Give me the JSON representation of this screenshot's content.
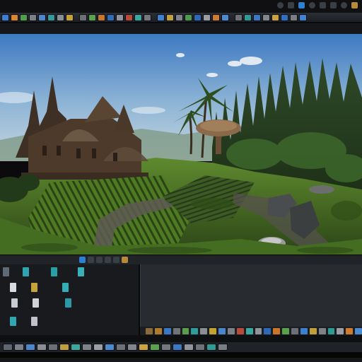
{
  "window": {
    "title": ""
  },
  "toolbar": {
    "buttons": [
      {
        "icon": "blue-gradient-icon",
        "color": "#3a7ed4"
      },
      {
        "icon": "orange-tool-icon",
        "color": "#d9872f"
      },
      {
        "icon": "green-tool-icon",
        "color": "#4f9e4a"
      },
      {
        "icon": "grey-tool-icon",
        "color": "#7b7f86"
      },
      {
        "icon": "blue-tool-icon",
        "color": "#4a86c9"
      },
      {
        "icon": "teal-tool-icon",
        "color": "#2f9c9a"
      },
      {
        "icon": "grey-tool-icon",
        "color": "#8a8d92"
      },
      {
        "icon": "yellow-tool-icon",
        "color": "#c4a232"
      },
      {
        "icon": "grey-tool-icon",
        "color": "#6c7076"
      },
      {
        "icon": "green-tool-icon",
        "color": "#5aa14c"
      },
      {
        "icon": "orange-tool-icon",
        "color": "#c9762a"
      },
      {
        "icon": "blue-tool-icon",
        "color": "#2f6cb8"
      },
      {
        "icon": "grey-tool-icon",
        "color": "#90939a"
      },
      {
        "icon": "red-tool-icon",
        "color": "#b94a3a"
      },
      {
        "icon": "teal-tool-icon",
        "color": "#3aa6a0"
      },
      {
        "icon": "grey-tool-icon",
        "color": "#74787e"
      },
      {
        "icon": "blue-tool-icon",
        "color": "#3d7fd0"
      },
      {
        "icon": "yellow-tool-icon",
        "color": "#bfa03a"
      },
      {
        "icon": "grey-tool-icon",
        "color": "#7e8188"
      },
      {
        "icon": "green-tool-icon",
        "color": "#4c9a4a"
      },
      {
        "icon": "blue-tool-icon",
        "color": "#2c6ab8"
      },
      {
        "icon": "grey-tool-icon",
        "color": "#9a9da3"
      },
      {
        "icon": "orange-tool-icon",
        "color": "#d07a30"
      },
      {
        "icon": "blue-tool-icon",
        "color": "#4c8ad0"
      },
      {
        "icon": "grey-tool-icon",
        "color": "#6e7278"
      },
      {
        "icon": "teal-tool-icon",
        "color": "#2e9a94"
      },
      {
        "icon": "blue-tool-icon",
        "color": "#3b78c4"
      },
      {
        "icon": "grey-tool-icon",
        "color": "#82858b"
      },
      {
        "icon": "yellow-tool-icon",
        "color": "#c9a43c"
      },
      {
        "icon": "blue-tool-icon",
        "color": "#2e6fc0"
      },
      {
        "icon": "grey-tool-icon",
        "color": "#7a7d83"
      },
      {
        "icon": "blue-tool-icon",
        "color": "#3f82d2"
      }
    ]
  },
  "top_right": {
    "icons": [
      "dropdown-icon",
      "settings-icon",
      "blue-status-icon",
      "search-icon",
      "pointer-icon",
      "play-icon",
      "warning-icon",
      "window-icon"
    ]
  },
  "viewport": {
    "scene": "fantasy-village-landscape",
    "colors": {
      "sky_top": "#3f7fc8",
      "sky_bottom": "#bcd3e0",
      "grass_dark": "#2e4a1c",
      "grass_light": "#7aa23a",
      "building": "#4d3a2a",
      "path": "#6e6a62"
    }
  },
  "content_browser": {
    "items": [
      {
        "icon": "folder-icon",
        "color": "#5e6a78"
      },
      {
        "icon": "asset-teal-icon",
        "color": "#2fa3b0"
      },
      {
        "icon": "asset-teal-icon",
        "color": "#29a0a6"
      },
      {
        "icon": "asset-teal-icon",
        "color": "#37b0ba"
      },
      {
        "icon": "asset-white-icon",
        "color": "#d9dde2"
      },
      {
        "icon": "asset-yellow-icon",
        "color": "#c7a43a"
      },
      {
        "icon": "asset-teal-icon",
        "color": "#33aeb6"
      },
      {
        "icon": "asset-white-icon",
        "color": "#c8ccd2"
      },
      {
        "icon": "asset-white-icon",
        "color": "#d0d4d9"
      },
      {
        "icon": "asset-teal-icon",
        "color": "#2c9aa6"
      },
      {
        "icon": "asset-white-icon",
        "color": "#bfc3c9"
      },
      {
        "icon": "asset-teal-icon",
        "color": "#30a6b0"
      }
    ]
  },
  "details_strip": {
    "items": [
      "#8a6a3a",
      "#b07b2c",
      "#3b78c4",
      "#6f7378",
      "#5a9e4c",
      "#2f9c9a",
      "#8a8d92",
      "#c4a232",
      "#4a86c9",
      "#7b7f86",
      "#b94a3a",
      "#3aa6a0",
      "#90939a",
      "#2c6ab8",
      "#c9762a",
      "#5aa14c",
      "#6c7076",
      "#3d7fd0",
      "#bfa03a",
      "#7e8188",
      "#2e9a94",
      "#9a9da3",
      "#d07a30",
      "#4c8ad0"
    ]
  },
  "bottom_toolbar": {
    "items": [
      "#5e6670",
      "#7a8088",
      "#4a86c9",
      "#8a8d92",
      "#6c7076",
      "#bfa03a",
      "#3aa6a0",
      "#7e8188",
      "#9a9da3",
      "#4c8ad0",
      "#6e7278",
      "#82858b",
      "#c9a43c",
      "#5aa14c",
      "#74787e",
      "#3b78c4",
      "#90939a",
      "#6f7378",
      "#2e9a94",
      "#7a7d83"
    ]
  }
}
